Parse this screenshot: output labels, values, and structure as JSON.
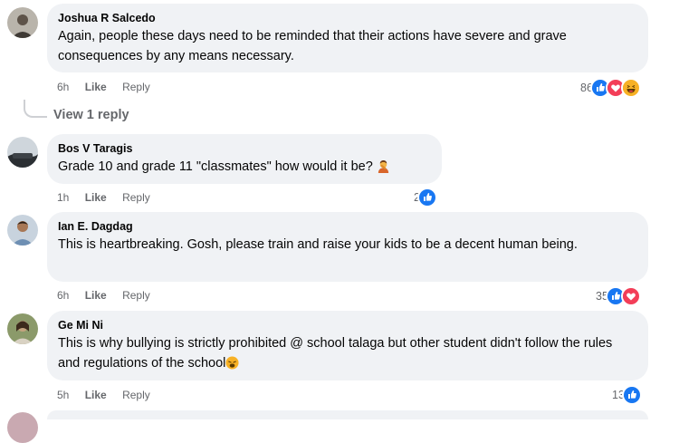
{
  "comments": [
    {
      "author": "Joshua R Salcedo",
      "text": "Again, people these days need to be reminded that their actions have severe and grave consequences by any means necessary.",
      "time": "6h",
      "like": "Like",
      "reply": "Reply",
      "reaction_count": "86",
      "reactions": [
        "like-icon",
        "love-icon",
        "haha-icon"
      ]
    },
    {
      "author": "Bos V Taragis",
      "text": "Grade 10 and grade 11 \"classmates\" how would it be?",
      "emoji": "person-facepalming-emoji",
      "time": "1h",
      "like": "Like",
      "reply": "Reply",
      "reaction_count": "2",
      "reactions": [
        "like-icon"
      ]
    },
    {
      "author": "Ian E. Dagdag",
      "text": "This is heartbreaking. Gosh, please train and raise your kids to be a decent human being.",
      "time": "6h",
      "like": "Like",
      "reply": "Reply",
      "reaction_count": "35",
      "reactions": [
        "like-icon",
        "love-icon"
      ]
    },
    {
      "author": "Ge Mi Ni",
      "text": "This is why bullying is strictly prohibited @ school talaga but other student didn't follow the rules and regulations of the school",
      "emoji": "weary-face-emoji",
      "time": "5h",
      "like": "Like",
      "reply": "Reply",
      "reaction_count": "13",
      "reactions": [
        "like-icon"
      ]
    }
  ],
  "view_replies": "View 1 reply",
  "colors": {
    "bubble": "#f0f2f5",
    "like": "#1877f2",
    "love": "#f33e58",
    "haha": "#f7b125",
    "meta": "#65676b"
  }
}
